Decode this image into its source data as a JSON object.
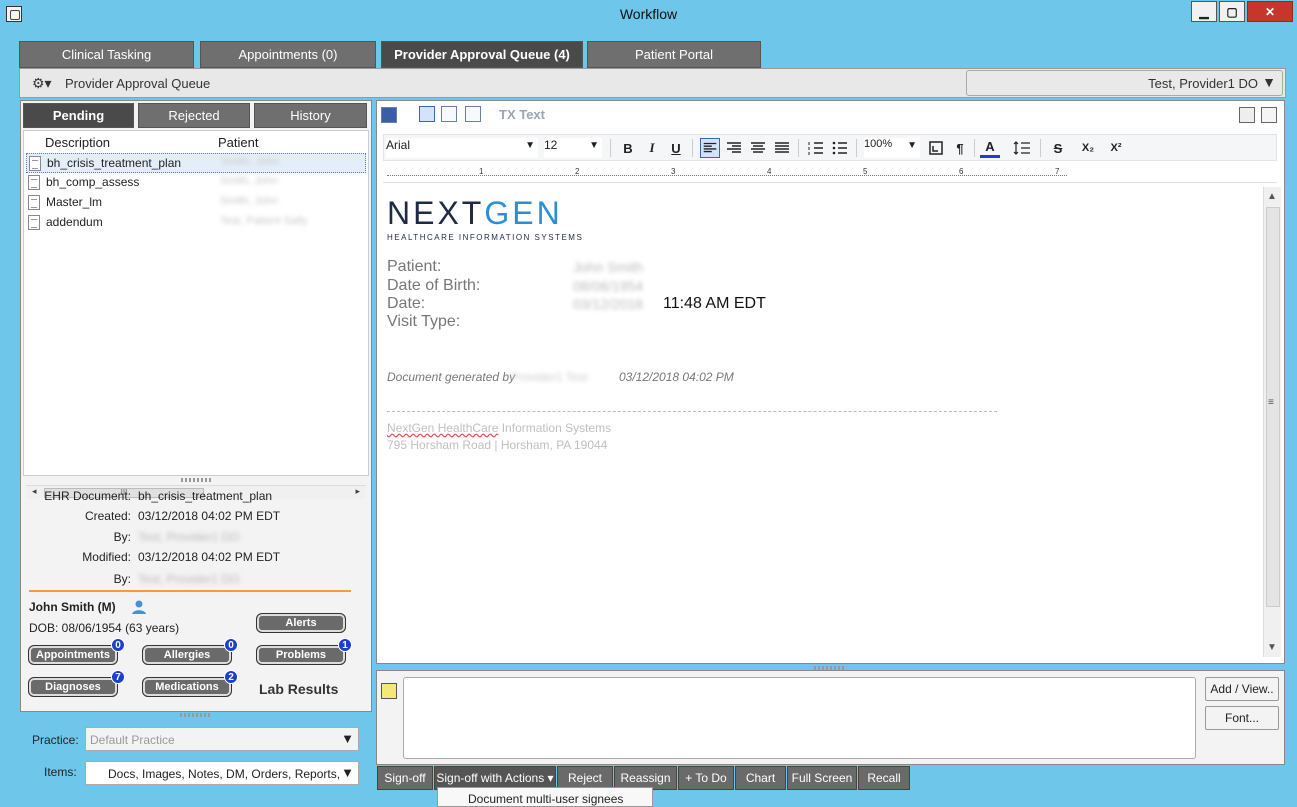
{
  "window": {
    "title": "Workflow",
    "min": "▁",
    "max": "▢",
    "close": "✕"
  },
  "main_tabs": [
    "Clinical Tasking",
    "Appointments (0)",
    "Provider Approval Queue (4)",
    "Patient Portal"
  ],
  "header": {
    "gear": "⚙▾",
    "title": "Provider Approval Queue",
    "provider": "Test, Provider1 DO",
    "provider_arrow": "▼"
  },
  "left": {
    "sub_tabs": [
      "Pending",
      "Rejected",
      "History"
    ],
    "columns": [
      "Description",
      "Patient"
    ],
    "rows": [
      {
        "desc": "bh_crisis_treatment_plan",
        "patient": "Smith, John"
      },
      {
        "desc": "bh_comp_assess",
        "patient": "Smith, John"
      },
      {
        "desc": "Master_lm",
        "patient": "Smith, John"
      },
      {
        "desc": "addendum",
        "patient": "Test, Patient Sally"
      }
    ],
    "scroll": {
      "left": "◂",
      "right": "▸",
      "thumb": "III"
    },
    "details": {
      "ehr_label": "EHR Document:",
      "ehr_value": "bh_crisis_treatment_plan",
      "created_label": "Created:",
      "created_value": "03/12/2018 04:02 PM EDT",
      "by1_label": "By:",
      "by1_value": "Test, Provider1 DO",
      "modified_label": "Modified:",
      "modified_value": "03/12/2018 04:02 PM EDT",
      "by2_label": "By:",
      "by2_value": "Test, Provider1 DO"
    },
    "patient": {
      "name": "John Smith (M)",
      "dob": "DOB:  08/06/1954 (63 years)"
    },
    "pills": {
      "alerts": "Alerts",
      "appointments": "Appointments",
      "appointments_badge": "0",
      "allergies": "Allergies",
      "allergies_badge": "0",
      "problems": "Problems",
      "problems_badge": "1",
      "diagnoses": "Diagnoses",
      "diagnoses_badge": "7",
      "medications": "Medications",
      "medications_badge": "2",
      "lab_results": "Lab Results"
    },
    "practice_label": "Practice:",
    "practice_value": "Default Practice",
    "items_label": "Items:",
    "items_value": "Docs, Images, Notes, DM, Orders, Reports, H",
    "dd_arrow": "▼"
  },
  "editor": {
    "tx_text": "TX Text",
    "font": "Arial",
    "size": "12",
    "zoom": "100%",
    "bold": "B",
    "italic": "I",
    "underline": "U",
    "pilcrow": "¶",
    "font_color": "A",
    "strike": "S",
    "subscript": "X₂",
    "superscript": "X²",
    "ruler": [
      "1",
      "2",
      "3",
      "4",
      "5",
      "6",
      "7"
    ],
    "combo_arrow": "▼",
    "scroll_up": "▲",
    "scroll_down": "▼",
    "scroll_mid": "≡"
  },
  "document": {
    "logo_next": "NEXT",
    "logo_gen": "GEN",
    "logo_tag": "HEALTHCARE INFORMATION SYSTEMS",
    "patient_label": "Patient:",
    "patient_value": "John Smith",
    "dob_label": "Date of Birth:",
    "dob_value": "08/06/1954",
    "date_label": "Date:",
    "date_value": "03/12/2018",
    "time": "11:48 AM EDT",
    "visit_label": "Visit Type:",
    "generated": "Document generated by",
    "generated_by": "Provider1 Test",
    "generated_date": "03/12/2018 04:02 PM",
    "footer_part1": "NextGen HealthCare",
    "footer_part2": " Information Systems",
    "footer_address": "795 Horsham Road | Horsham, PA 19044"
  },
  "notes": {
    "add_view": "Add / View..",
    "font": "Font..."
  },
  "actions": [
    "Sign-off",
    "Sign-off with Actions ▾",
    "Reject",
    "Reassign",
    "+ To Do",
    "Chart",
    "Full Screen",
    "Recall"
  ],
  "dropdown": {
    "item": "Document multi-user signees"
  }
}
